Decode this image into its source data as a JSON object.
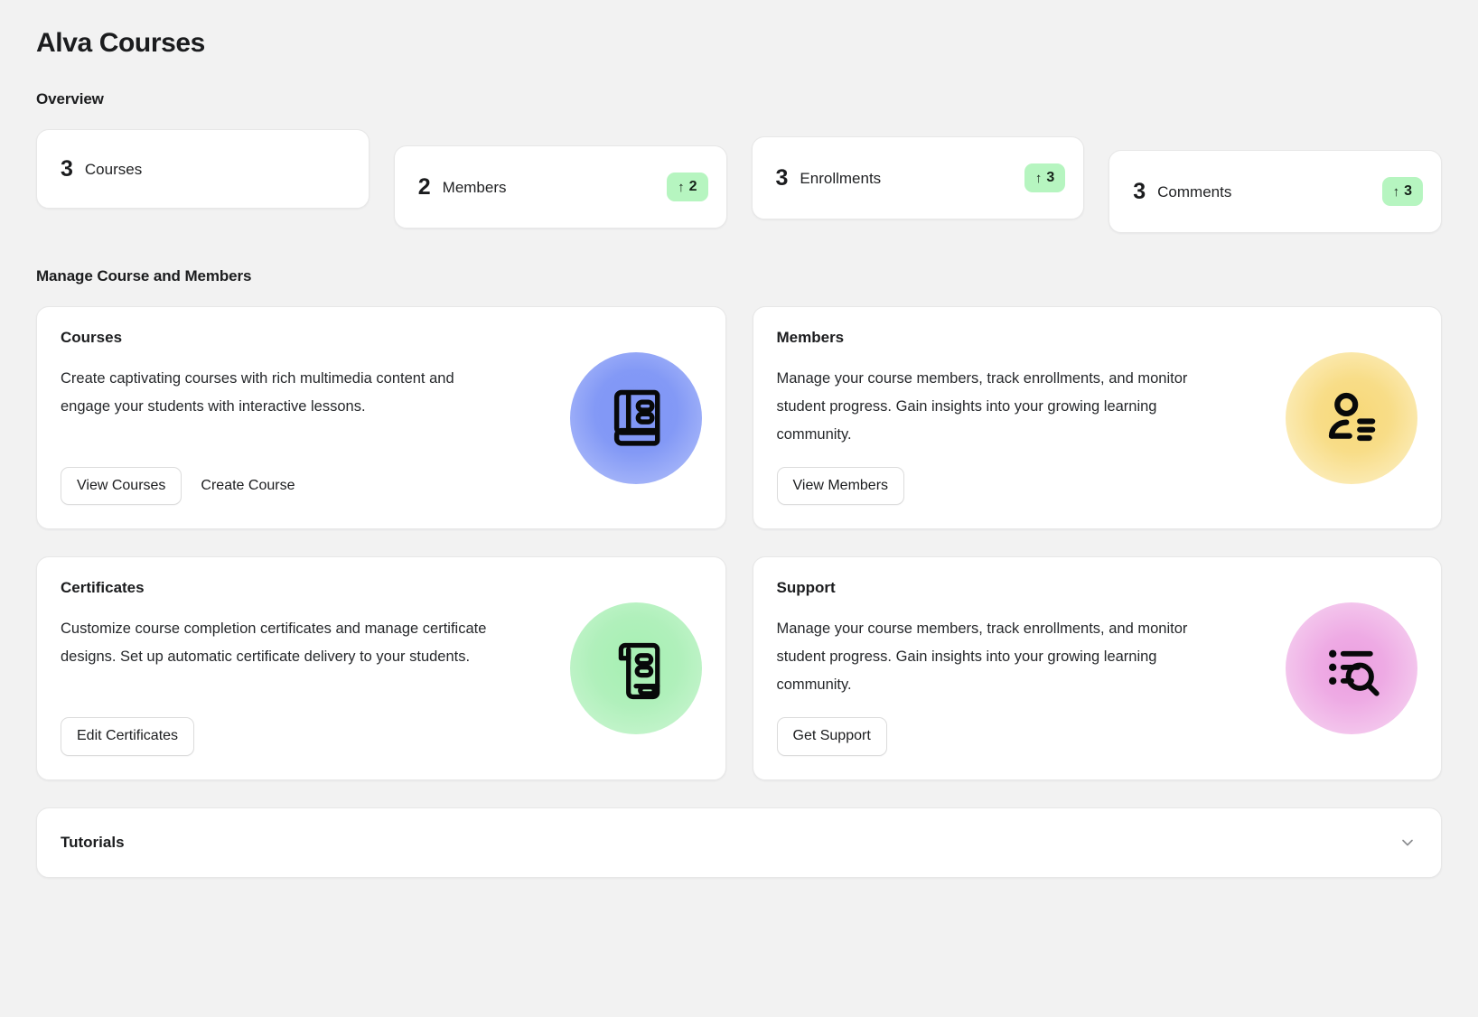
{
  "page": {
    "title": "Alva Courses"
  },
  "overview": {
    "heading": "Overview",
    "stats": [
      {
        "value": "3",
        "label": "Courses",
        "badge": null,
        "badge_arrow": null
      },
      {
        "value": "2",
        "label": "Members",
        "badge": "2",
        "badge_arrow": "↑"
      },
      {
        "value": "3",
        "label": "Enrollments",
        "badge": "3",
        "badge_arrow": "↑"
      },
      {
        "value": "3",
        "label": "Comments",
        "badge": "3",
        "badge_arrow": "↑"
      }
    ]
  },
  "manage": {
    "heading": "Manage Course and Members",
    "cards": [
      {
        "title": "Courses",
        "description": "Create captivating courses with rich multimedia content and engage your students with interactive lessons.",
        "primary_button": "View Courses",
        "secondary_button": "Create Course",
        "icon": "book-icon",
        "icon_background": "#8399f6"
      },
      {
        "title": "Members",
        "description": "Manage your course members, track enrollments, and monitor student progress. Gain insights into your growing learning community.",
        "primary_button": "View Members",
        "secondary_button": null,
        "icon": "user-list-icon",
        "icon_background": "#f8dd88"
      },
      {
        "title": "Certificates",
        "description": "Customize course completion certificates and manage certificate designs. Set up automatic certificate delivery to your students.",
        "primary_button": "Edit Certificates",
        "secondary_button": null,
        "icon": "certificate-scroll-icon",
        "icon_background": "#b0f0bb"
      },
      {
        "title": "Support",
        "description": "Manage your course members, track enrollments, and monitor student progress. Gain insights into your growing learning community.",
        "primary_button": "Get Support",
        "secondary_button": null,
        "icon": "list-search-icon",
        "icon_background": "#eeaae4"
      }
    ]
  },
  "tutorials": {
    "title": "Tutorials",
    "expand_icon": "chevron-down-icon"
  },
  "colors": {
    "page_background": "#f2f2f2",
    "card_background": "#ffffff",
    "card_border": "#e7e7e7",
    "badge_background": "#b6f5c0",
    "text_primary": "#1b1c1e"
  }
}
